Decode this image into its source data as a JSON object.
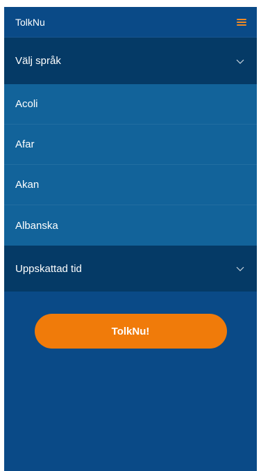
{
  "header": {
    "title": "TolkNu",
    "menu_icon": "hamburger-icon",
    "menu_color": "#f08a24"
  },
  "language_section": {
    "label": "Välj språk",
    "icon": "chevron-down-icon",
    "items": [
      {
        "label": "Acoli"
      },
      {
        "label": "Afar"
      },
      {
        "label": "Akan"
      },
      {
        "label": "Albanska"
      }
    ]
  },
  "time_section": {
    "label": "Uppskattad tid",
    "icon": "chevron-down-icon"
  },
  "cta": {
    "label": "TolkNu!",
    "color": "#f07b0a"
  },
  "colors": {
    "background": "#0a4a87",
    "section_header": "#053a66",
    "list_item": "#12639a"
  }
}
